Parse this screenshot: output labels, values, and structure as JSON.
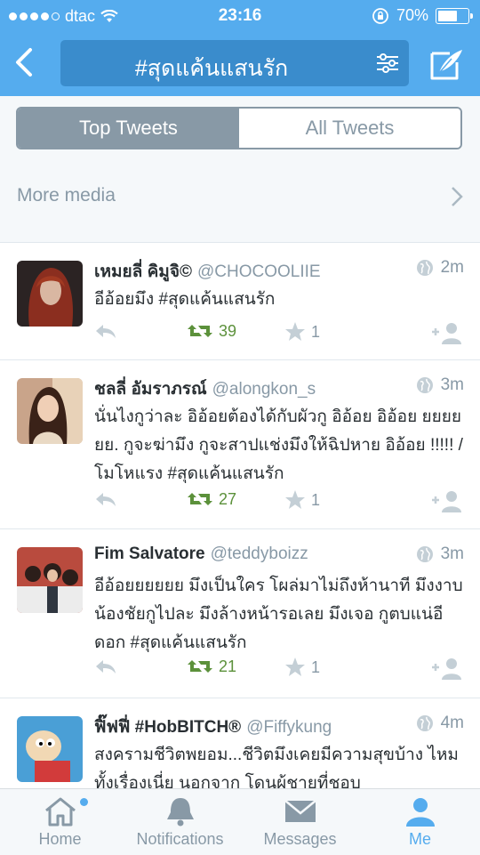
{
  "status": {
    "carrier": "dtac",
    "time": "23:16",
    "battery": "70%",
    "battery_level": 0.7
  },
  "header": {
    "query": "#สุดแค้นแสนรัก"
  },
  "segments": {
    "top": "Top Tweets",
    "all": "All Tweets"
  },
  "more_media": "More media",
  "tweets": [
    {
      "name": "เหมยลี่ คิมูจิ©",
      "handle": "@CHOCOOLIIE",
      "time": "2m",
      "text": "อีอ้อยมึง #สุดแค้นแสนรัก",
      "retweets": "39",
      "favorites": "1"
    },
    {
      "name": "ชลลี่ อัมราภรณ์",
      "handle": "@alongkon_s",
      "time": "3m",
      "text": "นั่นไงกูว่าละ อิอ้อยต้องได้กับผัวกู อิอ้อย อิอ้อย ยยยย ยย. กูจะฆ่ามึง กูจะสาปแช่งมึงให้ฉิปหาย อิอ้อย !!!!! /โมโหแรง #สุดแค้นแสนรัก",
      "retweets": "27",
      "favorites": "1"
    },
    {
      "name": "Fim Salvatore",
      "handle": "@teddyboizz",
      "time": "3m",
      "text": "อีอ้อยยยยยย มึงเป็นใคร โผล่มาไม่ถึงห้านาที มึงงาบน้องชัยกูไปละ มึงล้างหน้ารอเลย มึงเจอ กูตบแน่อีดอก #สุดแค้นแสนรัก",
      "retweets": "21",
      "favorites": "1"
    },
    {
      "name": "ฟิ๊ฟฟี่ #HobBITCH®",
      "handle": "@Fiffykung",
      "time": "4m",
      "text": "สงครามชีวิตพยอม...ชีวิตมึงเคยมีความสุขบ้าง ไหม ทั้งเรื่องเนี่ย นอกจาก โดนผู้ชายที่ชอบ"
    }
  ],
  "tabs": {
    "home": "Home",
    "notifications": "Notifications",
    "messages": "Messages",
    "me": "Me"
  }
}
